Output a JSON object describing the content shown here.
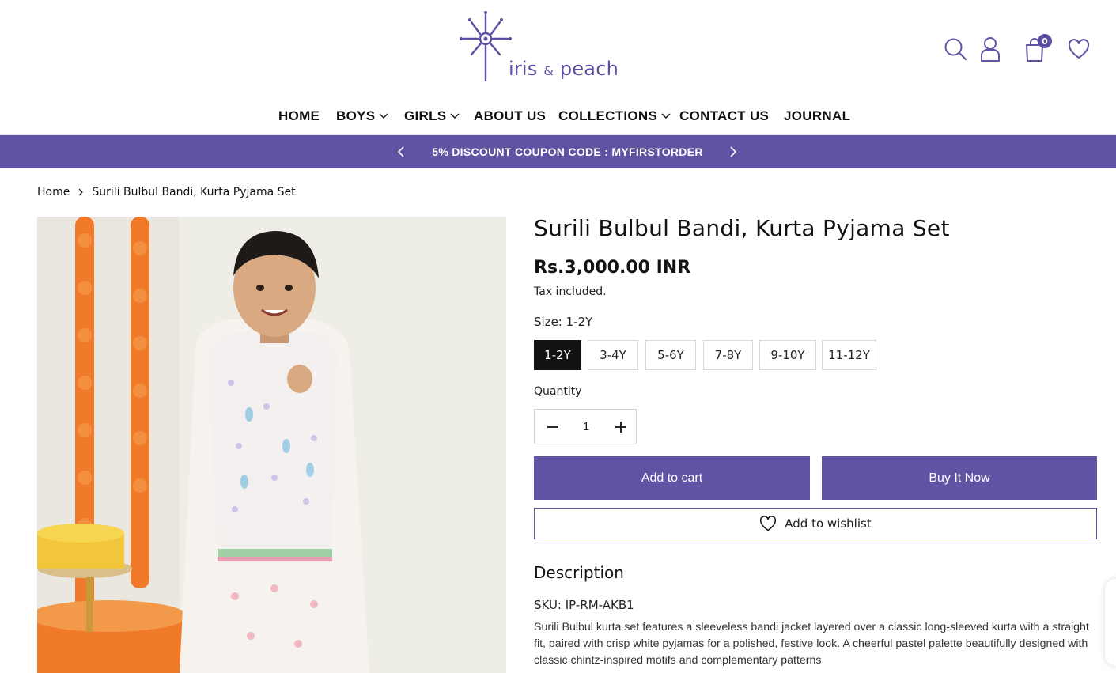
{
  "brand": {
    "logo_name": "iris",
    "logo_amp": "&",
    "logo_name2": "peach",
    "accent_color": "#5f54a4"
  },
  "header": {
    "cart_count": "0",
    "icons": [
      "search-icon",
      "user-icon",
      "cart-icon",
      "heart-icon"
    ]
  },
  "nav": {
    "items": [
      {
        "label": "HOME",
        "dropdown": false
      },
      {
        "label": "BOYS",
        "dropdown": true
      },
      {
        "label": "GIRLS",
        "dropdown": true
      },
      {
        "label": "ABOUT US",
        "dropdown": false
      },
      {
        "label": "COLLECTIONS",
        "dropdown": true
      },
      {
        "label": "CONTACT US",
        "dropdown": false
      },
      {
        "label": "JOURNAL",
        "dropdown": false
      }
    ]
  },
  "announcement": {
    "text": "5% DISCOUNT COUPON CODE : MYFIRSTORDER"
  },
  "breadcrumb": {
    "home": "Home",
    "current": "Surili Bulbul Bandi, Kurta Pyjama Set"
  },
  "product": {
    "title": "Surili Bulbul Bandi, Kurta Pyjama Set",
    "price": "Rs.3,000.00 INR",
    "tax_note": "Tax included.",
    "size_label": "Size: 1-2Y",
    "sizes": [
      "1-2Y",
      "3-4Y",
      "5-6Y",
      "7-8Y",
      "9-10Y",
      "11-12Y"
    ],
    "selected_size": "1-2Y",
    "quantity_label": "Quantity",
    "quantity": "1",
    "add_to_cart": "Add to cart",
    "buy_now": "Buy It Now",
    "add_to_wishlist": "Add to wishlist",
    "description_title": "Description",
    "sku": "SKU: IP-RM-AKB1",
    "description": "Surili Bulbul kurta set features a sleeveless bandi jacket layered over a classic long-sleeved kurta with a straight fit, paired with crisp white pyjamas for a polished, festive look. A cheerful pastel palette beautifully designed with classic chintz-inspired motifs and complementary patterns"
  }
}
